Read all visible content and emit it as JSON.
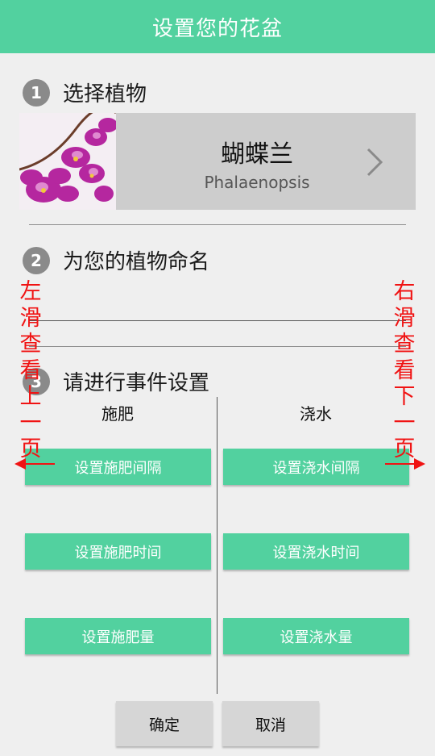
{
  "header": {
    "title": "设置您的花盆"
  },
  "steps": [
    {
      "num": "1",
      "label": "选择植物"
    },
    {
      "num": "2",
      "label": "为您的植物命名"
    },
    {
      "num": "3",
      "label": "请进行事件设置"
    }
  ],
  "plant": {
    "name": "蝴蝶兰",
    "latin": "Phalaenopsis",
    "photo_icon": "orchid-photo",
    "chevron_icon": "chevron-right-icon"
  },
  "name_input": {
    "value": "",
    "placeholder": ""
  },
  "columns": {
    "left": {
      "title": "施肥",
      "buttons": [
        "设置施肥间隔",
        "设置施肥时间",
        "设置施肥量"
      ]
    },
    "right": {
      "title": "浇水",
      "buttons": [
        "设置浇水间隔",
        "设置浇水时间",
        "设置浇水量"
      ]
    }
  },
  "footer": {
    "confirm": "确定",
    "cancel": "取消"
  },
  "swipe_hints": {
    "left": [
      "左",
      "滑",
      "查",
      "看",
      "上",
      "一",
      "页"
    ],
    "right": [
      "右",
      "滑",
      "查",
      "看",
      "下",
      "一",
      "页"
    ]
  },
  "colors": {
    "accent": "#52d19f",
    "hint": "#f01313",
    "card": "#cdcdcd",
    "footer_button": "#d6d6d6",
    "background": "#efefef"
  }
}
